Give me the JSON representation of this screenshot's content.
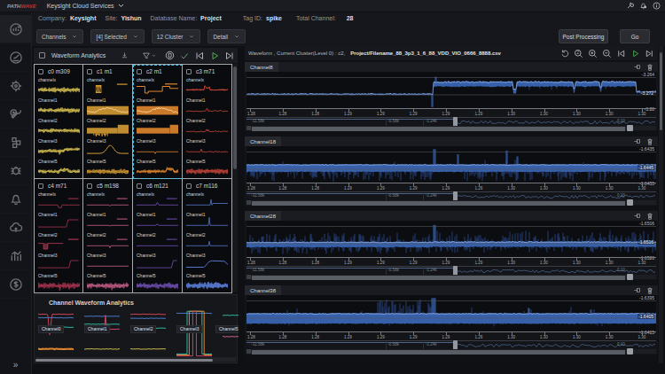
{
  "app": {
    "logo": {
      "part1": "PATH",
      "part2": "WAVE"
    },
    "product": "Keysight Cloud Services",
    "topbar_icons": [
      "wrench",
      "bell",
      "info"
    ]
  },
  "toolbar": {
    "info": [
      {
        "label": "Company:",
        "value": "Keysight"
      },
      {
        "label": "Site:",
        "value": "Yishun"
      },
      {
        "label": "Database Name:",
        "value": "Project"
      },
      {
        "label": "Tag ID:",
        "value": "spike"
      },
      {
        "label": "Total Channel:",
        "value": "28"
      }
    ],
    "dropdowns": [
      {
        "id": "channels",
        "label": "Channels"
      },
      {
        "id": "selected",
        "label": "[4] Selected"
      },
      {
        "id": "cluster",
        "label": "12 Cluster"
      },
      {
        "id": "detail",
        "label": "Detail"
      }
    ],
    "actions": {
      "post_processing": "Post Processing",
      "go": "Go"
    }
  },
  "sidebar": {
    "items": [
      "analytics",
      "gauge",
      "gear",
      "tools",
      "blocks",
      "debug",
      "bell",
      "cloud",
      "chart",
      "dollar"
    ],
    "expand": "»"
  },
  "left_panel": {
    "title": "Waveform Analytics",
    "icons": [
      "download",
      "filter",
      "d-badge",
      "check",
      "skip-back",
      "play",
      "skip-forward"
    ],
    "channel_labels": [
      "channelx",
      "Channel1",
      "Channel2",
      "Channel3",
      "Channel5"
    ],
    "clusters": [
      {
        "label": "c0 m309",
        "color": "#d6c050",
        "selected": false,
        "waves": [
          {
            "k": "noise",
            "amp": 0.5
          },
          {
            "k": "noise",
            "amp": 0.5
          },
          {
            "k": "noise",
            "amp": 0.45
          },
          {
            "k": "noise",
            "amp": 0.38,
            "dn": [
              {
                "x": 0.52,
                "h": 0.55
              }
            ],
            "raise": 0.62
          },
          {
            "k": "noise",
            "amp": 0.45,
            "bump": {
              "x": 0.63,
              "w": 0.22,
              "h": 0.5
            }
          }
        ]
      },
      {
        "label": "c1 m1",
        "color": "#d39a33",
        "selected": false,
        "waves": [
          {
            "k": "box",
            "x": 0.28,
            "w": 0.14,
            "zig": true,
            "tr": true
          },
          {
            "k": "wavy",
            "fill": true
          },
          {
            "k": "band",
            "dnburst": [
              0.15,
              0.5
            ],
            "step": 0.74
          },
          {
            "k": "gauss",
            "x": 0.56,
            "w": 0.13
          },
          {
            "k": "noise",
            "amp": 0.5
          }
        ]
      },
      {
        "label": "c2 m1",
        "color": "#e0862e",
        "selected": true,
        "waves": [
          {
            "k": "steps",
            "tr": true
          },
          {
            "k": "wavy",
            "fill": true
          },
          {
            "k": "band",
            "step": 0.8
          },
          {
            "k": "flat",
            "dn": [
              {
                "x": 0.44,
                "h": 0.8
              }
            ]
          },
          {
            "k": "noise",
            "amp": 0.4,
            "pulse": {
              "x": 0.8,
              "w": 0.16
            }
          }
        ]
      },
      {
        "label": "c3 m71",
        "color": "#c4453a",
        "selected": false,
        "waves": [
          {
            "k": "noise",
            "amp": 0.18,
            "burst": {
              "x": 0.5,
              "w": 0.14
            }
          },
          {
            "k": "flat",
            "up": [
              {
                "x": 0.5,
                "h": 0.95
              }
            ],
            "fuzz": true
          },
          {
            "k": "flat",
            "up": [
              {
                "x": 0.48,
                "h": 0.6
              },
              {
                "x": 0.54,
                "h": 0.35
              }
            ],
            "fuzz": true
          },
          {
            "k": "flat",
            "up": [
              {
                "x": 0.36,
                "h": 0.25
              }
            ],
            "fuzz": true
          },
          {
            "k": "noise",
            "amp": 0.55
          }
        ]
      },
      {
        "label": "c4 m71",
        "color": "#ab3450",
        "selected": false,
        "waves": [
          {
            "k": "flat",
            "tr": true,
            "blob": {
              "x": 0.52,
              "h": 0.7
            }
          },
          {
            "k": "step",
            "x": 0.72
          },
          {
            "k": "box",
            "x": 0.18,
            "w": 0.1,
            "dir": -1,
            "tr": true
          },
          {
            "k": "step",
            "x": 0.78
          },
          {
            "k": "noise",
            "amp": 0.62,
            "dn": [
              {
                "x": 0.52,
                "h": 0.7
              },
              {
                "x": 0.74,
                "h": 0.55
              }
            ]
          }
        ]
      },
      {
        "label": "c5 m198",
        "color": "#c65e88",
        "selected": false,
        "waves": [
          {
            "k": "flat",
            "tr": true,
            "dn": [
              {
                "x": 0.55,
                "h": 0.3
              }
            ]
          },
          {
            "k": "flat",
            "tr": true,
            "dn": [
              {
                "x": 0.55,
                "h": 0.2
              }
            ]
          },
          {
            "k": "flat",
            "tr": true,
            "dn": [
              {
                "x": 0.55,
                "h": 0.55
              }
            ]
          },
          {
            "k": "flat",
            "dn": [
              {
                "x": 0.5,
                "h": 0.2
              }
            ]
          },
          {
            "k": "noise",
            "amp": 0.6,
            "dn": [
              {
                "x": 0.6,
                "h": 0.5
              }
            ]
          }
        ]
      },
      {
        "label": "c6 m121",
        "color": "#7050b5",
        "selected": false,
        "waves": [
          {
            "k": "flat",
            "tr": true,
            "up": [
              {
                "x": 0.5,
                "h": 0.9
              }
            ]
          },
          {
            "k": "flat",
            "tr": true,
            "up": [
              {
                "x": 0.5,
                "h": 0.5
              }
            ]
          },
          {
            "k": "flat",
            "tr": true
          },
          {
            "k": "step",
            "x": 0.88
          },
          {
            "k": "noise",
            "amp": 0.6,
            "dn": [
              {
                "x": 0.47,
                "h": 0.5
              },
              {
                "x": 0.53,
                "h": 0.4
              }
            ]
          }
        ]
      },
      {
        "label": "c7 m116",
        "color": "#5577cc",
        "selected": false,
        "waves": [
          {
            "k": "flat",
            "up": [
              {
                "x": 0.6,
                "h": 0.75
              }
            ],
            "endhi": true
          },
          {
            "k": "flat",
            "up": [
              {
                "x": 0.55,
                "h": 1
              }
            ]
          },
          {
            "k": "flat",
            "up": [
              {
                "x": 0.55,
                "h": 0.55
              }
            ]
          },
          {
            "k": "smoothstep",
            "x": 0.5
          },
          {
            "k": "noise",
            "amp": 0.7,
            "fill": true
          }
        ]
      }
    ],
    "channel_panel": {
      "title": "Channel Waveform Analytics",
      "tiles": [
        {
          "label": "Channel0",
          "lines": [
            {
              "c": "#cc4455",
              "lv": 0.1,
              "dip": {
                "x": 0.33,
                "h": 0.45
              }
            },
            {
              "c": "#4878c8",
              "lv": 0.17
            },
            {
              "c": "#2fb5a0",
              "lv": 0.36
            },
            {
              "c": "#e0862e",
              "lv": 0.8,
              "th": 2
            }
          ]
        },
        {
          "label": "Channel1",
          "lines": [
            {
              "c": "#4878c8",
              "lv": 0.14
            },
            {
              "c": "#2fb5a0",
              "lv": 0.3
            },
            {
              "c": "#cc4466",
              "lv": 0.4,
              "spike": {
                "x": 0.6,
                "h": 0.28
              }
            },
            {
              "c": "#c8b84a",
              "lv": 0.8
            }
          ]
        },
        {
          "label": "Channel2",
          "lines": [
            {
              "c": "#cc4455",
              "lv": 0.1
            },
            {
              "c": "#4878c8",
              "lv": 0.18
            },
            {
              "c": "#2fb5a0",
              "lv": 0.38
            },
            {
              "c": "#c8b84a",
              "lv": 0.8
            }
          ]
        },
        {
          "label": "Channel3",
          "lines": [
            {
              "c": "#4878c8",
              "lv": 0.08
            },
            {
              "c": "#2fb5a0",
              "sq": {
                "x0": 0.3,
                "x1": 0.72
              },
              "lv": 0.9
            },
            {
              "c": "#e0862e",
              "sq": {
                "x0": 0.36,
                "x1": 0.78
              },
              "lv": 0.92
            },
            {
              "c": "#cc4466",
              "sq": {
                "x0": 0.46,
                "x1": 0.56
              },
              "lv": 0.94
            }
          ]
        },
        {
          "label": "Channel5",
          "lines": [
            {
              "c": "#2fb5a0",
              "lv": 0.12
            },
            {
              "c": "#c65e88",
              "lv": 0.55
            }
          ]
        }
      ]
    }
  },
  "right_panel": {
    "title": "Waveform , Current Cluster(Level 0) : c2,",
    "file": "Project/Filename_88_3p3_1_6_88_VDD_VIO_0666_8888.csv",
    "icons": [
      "undo",
      "zoom-2x",
      "zoom-in",
      "zoom-out",
      "skip-back",
      "play",
      "skip-forward"
    ],
    "x_ticks": [
      "1.28",
      "1.28",
      "1.28",
      "1.29",
      "1.29",
      "1.29",
      "1.29",
      "1.29",
      "1.30",
      "1.30",
      "1.30",
      "1.30",
      "1.30"
    ],
    "overview_labels": [
      {
        "text": "-11.58k",
        "x": 0.012
      },
      {
        "text": "-0.58k",
        "x": 0.345
      },
      {
        "text": "-1.24k",
        "x": 0.437
      }
    ],
    "overview_end_label": "0.10",
    "handle_x": 0.505,
    "strips": [
      {
        "name": "Channel8",
        "y_labels": [
          "-3.264",
          "-3.272",
          "-3.28"
        ],
        "wave": {
          "segs": [
            {
              "x0": 0,
              "x1": 0.452,
              "level": 0.615,
              "band": 0.02,
              "noise": 0.012
            },
            {
              "x0": 0.452,
              "x1": 0.456,
              "level": 0.615,
              "band": 0.02,
              "noise": 0.01,
              "vspike": 0.97
            },
            {
              "x0": 0.456,
              "x1": 0.952,
              "level": 0.335,
              "band": 0.07,
              "noise": 0.016,
              "dn": 0.05,
              "dnh": 0.1,
              "ups": [
                {
                  "x": 0.463,
                  "to": 0.14
                }
              ],
              "dips": [
                {
                  "x": 0.655,
                  "w": 0.007,
                  "to": 0.6
                },
                {
                  "x": 0.8,
                  "w": 0.006,
                  "to": 0.58
                },
                {
                  "x": 0.865,
                  "w": 0.005,
                  "to": 0.55
                }
              ]
            },
            {
              "x0": 0.952,
              "x1": 1,
              "level": 0.56,
              "band": 0.03,
              "noise": 0.016
            }
          ]
        }
      },
      {
        "name": "Channel18",
        "y_labels": [
          "-1.6435",
          "-1.6445",
          "-1.6455"
        ],
        "wave": {
          "segs": [
            {
              "x0": 0,
              "x1": 0.455,
              "level": 0.6,
              "band": 0.105,
              "noise": 0.009,
              "dn": 0.4,
              "dnh": 0.26,
              "up": 0.015,
              "uph": 0.12
            },
            {
              "x0": 0.455,
              "x1": 0.462,
              "level": 0.6,
              "band": 0.105,
              "noise": 0.009,
              "vspikeup": 0.08
            },
            {
              "x0": 0.462,
              "x1": 0.53,
              "level": 0.6,
              "band": 0.105,
              "noise": 0.009,
              "dn": 0.08,
              "dnh": 0.15,
              "ups": [
                {
                  "x": 0.516,
                  "to": 0.22
                }
              ]
            },
            {
              "x0": 0.53,
              "x1": 1,
              "level": 0.6,
              "band": 0.105,
              "noise": 0.009,
              "dn": 0.45,
              "dnh": 0.26,
              "up": 0.015,
              "uph": 0.14,
              "ups": [
                {
                  "x": 0.635,
                  "to": 0.12
                },
                {
                  "x": 0.662,
                  "to": 0.28
                }
              ]
            }
          ]
        }
      },
      {
        "name": "Channel28",
        "y_labels": [
          "-1.6506",
          "-1.6516",
          "-1.6526"
        ],
        "wave": {
          "segs": [
            {
              "x0": 0,
              "x1": 0.455,
              "level": 0.655,
              "band": 0.075,
              "noise": 0.012,
              "dn": 0.32,
              "dnh": 0.18,
              "up": 0.4,
              "uph": 0.24
            },
            {
              "x0": 0.455,
              "x1": 0.462,
              "level": 0.645,
              "band": 0.075,
              "noise": 0.012,
              "vspikeup": 0.12
            },
            {
              "x0": 0.462,
              "x1": 1,
              "level": 0.645,
              "band": 0.075,
              "noise": 0.012,
              "dn": 0.3,
              "dnh": 0.17,
              "up": 0.45,
              "uph": 0.3
            }
          ]
        }
      },
      {
        "name": "Channel38",
        "y_labels": [
          "-1.6395",
          "-1.6405",
          "-1.6415"
        ],
        "wave": {
          "segs": [
            {
              "x0": 0,
              "x1": 0.32,
              "level": 0.64,
              "band": 0.145,
              "noise": 0.01,
              "dn": 0.04,
              "dnh": 0.1,
              "up": 0.03,
              "uph": 0.15
            },
            {
              "x0": 0.32,
              "x1": 0.452,
              "level": 0.64,
              "band": 0.145,
              "noise": 0.01,
              "up": 0.55,
              "uph": 0.4,
              "dn": 0.03,
              "dnh": 0.08
            },
            {
              "x0": 0.452,
              "x1": 0.462,
              "level": 0.64,
              "band": 0.145,
              "noise": 0.01,
              "vspikeup": 0.08
            },
            {
              "x0": 0.462,
              "x1": 1,
              "level": 0.64,
              "band": 0.145,
              "noise": 0.01,
              "dn": 0.02,
              "dnh": 0.08,
              "up": 0.05,
              "uph": 0.18,
              "ups": [
                {
                  "x": 0.69,
                  "to": 0.36
                },
                {
                  "x": 0.84,
                  "to": 0.4
                }
              ]
            }
          ]
        }
      }
    ]
  },
  "colors": {
    "accent_cyan": "#3cc6ea",
    "green": "#4caf50",
    "wave_blue": "#3760ab",
    "wave_blue_light": "#9cb6e4",
    "logo_red": "#c43b3b"
  }
}
